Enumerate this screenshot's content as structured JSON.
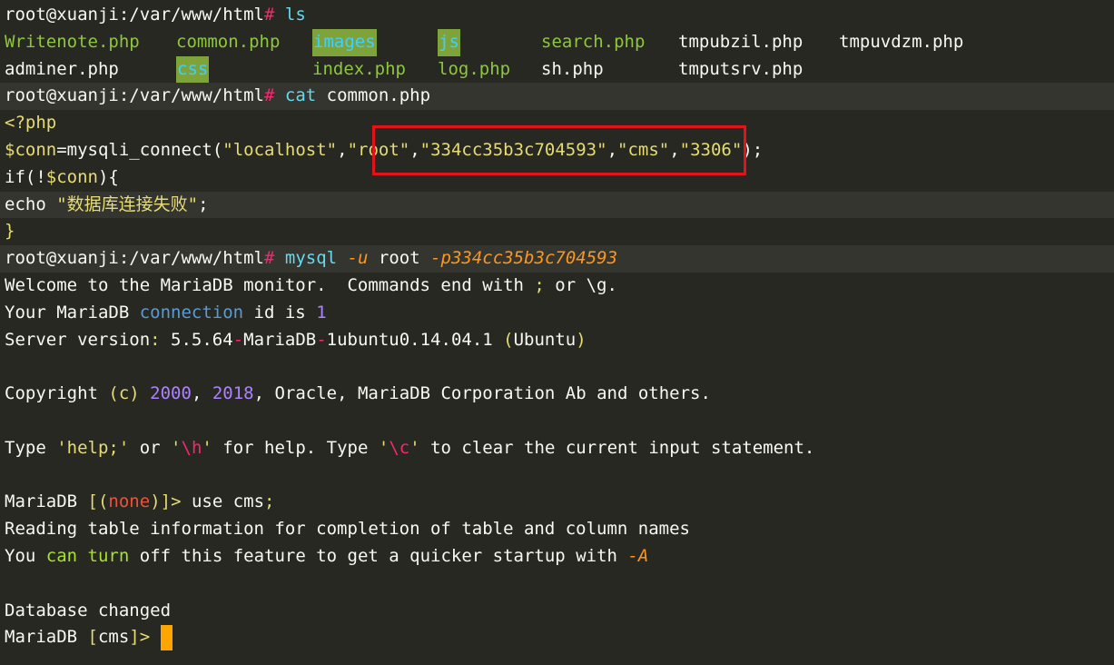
{
  "colors": {
    "background": "#272822",
    "foreground": "#f8f8f2",
    "prompt_hash": "#f92672",
    "command": "#66d9ef",
    "string": "#e6db74",
    "number": "#ae81ff",
    "flag": "#fd971f",
    "dir_bg": "#7ea33a",
    "highlight_box": "#e3131b",
    "cursor": "#ffa500"
  },
  "prompt": {
    "user_path": "root@xuanji:/var/www/html",
    "hash": "#"
  },
  "ls": {
    "command": "ls",
    "row1": [
      "Writenote.php",
      "common.php",
      "images",
      "js",
      "search.php",
      "tmpubzil.php",
      "tmpuvdzm.php"
    ],
    "row2": [
      "adminer.php",
      "css",
      "index.php",
      "log.php",
      "sh.php",
      "tmputsrv.php"
    ]
  },
  "cat": {
    "command": "cat",
    "arg": "common.php"
  },
  "php": {
    "open": "<?php",
    "var": "$conn",
    "eq": "=",
    "func": "mysqli_connect",
    "paren_open": "(",
    "host": "\"localhost\"",
    "comma": ",",
    "user": "\"root\"",
    "password": "\"334cc35b3c704593\"",
    "db": "\"cms\"",
    "port": "\"3306\"",
    "paren_close": ");",
    "if_open": "if(!",
    "if_var": "$conn",
    "if_close": "){",
    "echo": "echo ",
    "message": "\"数据库连接失败\"",
    "semicolon": ";",
    "close_brace": "}"
  },
  "mysql": {
    "command": "mysql",
    "flag_u": "-u",
    "user": "root",
    "flag_p": "-p334cc35b3c704593"
  },
  "output": {
    "welcome_a": "Welcome to the MariaDB monitor.  Commands end with ",
    "welcome_semicolon": ";",
    "welcome_b": " or \\g.",
    "conn_a": "Your MariaDB ",
    "conn_word": "connection",
    "conn_b": " id is ",
    "conn_id": "1",
    "server_a": "Server version",
    "server_colon": ":",
    "server_b": " 5.5.64",
    "server_dash": "-",
    "server_c": "MariaDB",
    "server_dash2": "-",
    "server_d": "1ubuntu0.14.04.1 ",
    "server_paren_open": "(",
    "server_e": "Ubuntu",
    "server_paren_close": ")",
    "copyright_a": "Copyright ",
    "copyright_c": "(c)",
    "copyright_sp": " ",
    "year1": "2000",
    "copyright_comma": ", ",
    "year2": "2018",
    "copyright_b": ", Oracle, MariaDB Corporation Ab and others.",
    "type_a": "Type ",
    "help_str": "'help;'",
    "type_or": " or ",
    "h_str_open": "'",
    "h_str_code": "\\h",
    "h_str_close": "'",
    "type_b": " for help. Type ",
    "c_str_open": "'",
    "c_str_code": "\\c",
    "c_str_close": "'",
    "type_c": " to clear the current input statement.",
    "mariadb": "MariaDB ",
    "bracket_open": "[",
    "none_paren_open": "(",
    "none": "none",
    "none_paren_close": ")",
    "bracket_close": "]>",
    "use_cmd": " use cms",
    "use_semicolon": ";",
    "reading": "Reading table information for completion of table and column names",
    "you_a": "You ",
    "you_can": "can",
    "you_sp": " ",
    "you_turn": "turn",
    "you_b": " off this feature to get a quicker startup with ",
    "you_flag": "-A",
    "db_changed": "Database changed",
    "final_bracket_open": "[",
    "final_db": "cms",
    "final_bracket_close": "]>",
    "final_space": " "
  }
}
